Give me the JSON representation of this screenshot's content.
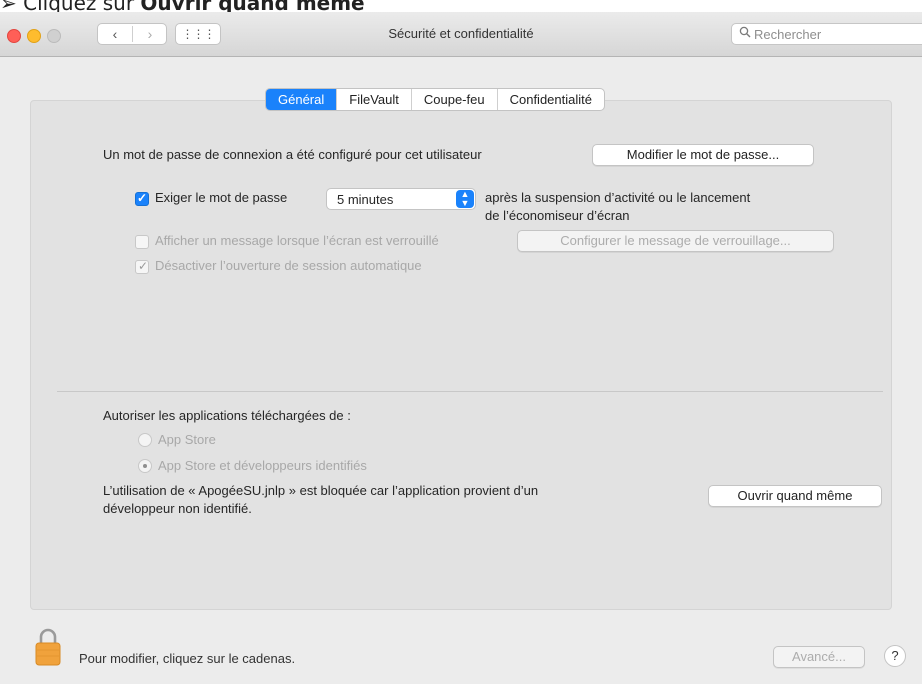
{
  "caption": {
    "bullet": "➢",
    "prefix": "Cliquez sur ",
    "bold": "Ouvrir quand même"
  },
  "window": {
    "title": "Sécurité et confidentialité",
    "nav": {
      "back": "‹",
      "forward": "›",
      "grid": "⋮⋮⋮"
    },
    "search": {
      "placeholder": "Rechercher",
      "icon": "magnifier-icon"
    },
    "traffic_lights": {
      "close": "#ff5f57",
      "minimize": "#febc2e",
      "maximize": "#d0d0d0"
    }
  },
  "tabs": [
    {
      "label": "Général",
      "active": true
    },
    {
      "label": "FileVault",
      "active": false
    },
    {
      "label": "Coupe-feu",
      "active": false
    },
    {
      "label": "Confidentialité",
      "active": false
    }
  ],
  "general": {
    "password_text": "Un mot de passe de connexion a été configuré pour cet utilisateur",
    "change_password_button": "Modifier le mot de passe...",
    "require_password_label": "Exiger le mot de passe",
    "require_password_checked": true,
    "require_password_delay": "5 minutes",
    "after_suspend_text_1": "après la suspension d’activité ou le lancement",
    "after_suspend_text_2": "de l’économiseur d’écran",
    "show_message_label": "Afficher un message lorsque l’écran est verrouillé",
    "show_message_checked": false,
    "configure_message_button": "Configurer le message de verrouillage...",
    "disable_autologin_label": "Désactiver l’ouverture de session automatique",
    "disable_autologin_checked": true,
    "allow_apps_label": "Autoriser les applications téléchargées de :",
    "option_app_store": "App Store",
    "option_app_store_dev": "App Store et développeurs identifiés",
    "selected_option": "App Store et développeurs identifiés",
    "blocked_text_1": "L’utilisation de « ApogéeSU.jnlp » est bloquée car l’application provient d’un",
    "blocked_text_2": "développeur non identifié.",
    "open_anyway_button": "Ouvrir quand même"
  },
  "footer": {
    "lock_text": "Pour modifier, cliquez sur le cadenas.",
    "advanced_button": "Avancé...",
    "help_button": "?"
  },
  "colors": {
    "accent": "#1a82fb",
    "lock_orange": "#f0a23c"
  }
}
